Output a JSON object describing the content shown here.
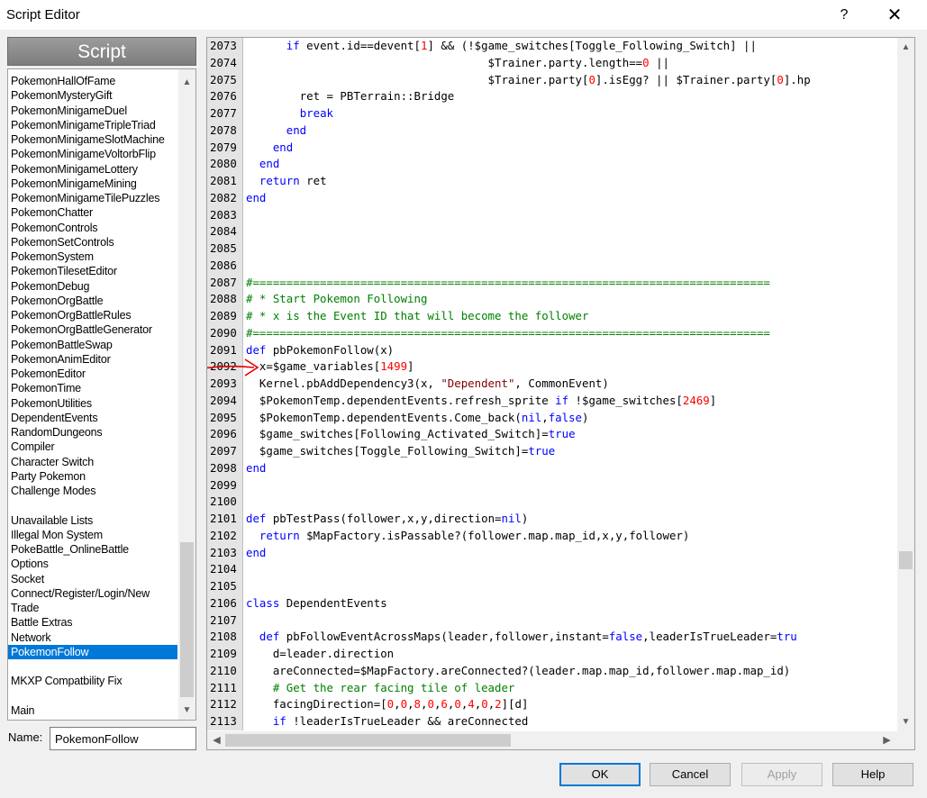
{
  "window": {
    "title": "Script Editor",
    "help_label": "?",
    "close_label": "✕"
  },
  "sidebar": {
    "header": "Script",
    "items": [
      {
        "label": "PokemonHallOfFame"
      },
      {
        "label": "PokemonMysteryGift"
      },
      {
        "label": "PokemonMinigameDuel"
      },
      {
        "label": "PokemonMinigameTripleTriad"
      },
      {
        "label": "PokemonMinigameSlotMachine"
      },
      {
        "label": "PokemonMinigameVoltorbFlip"
      },
      {
        "label": "PokemonMinigameLottery"
      },
      {
        "label": "PokemonMinigameMining"
      },
      {
        "label": "PokemonMinigameTilePuzzles"
      },
      {
        "label": "PokemonChatter"
      },
      {
        "label": "PokemonControls"
      },
      {
        "label": "PokemonSetControls"
      },
      {
        "label": "PokemonSystem"
      },
      {
        "label": "PokemonTilesetEditor"
      },
      {
        "label": "PokemonDebug"
      },
      {
        "label": "PokemonOrgBattle"
      },
      {
        "label": "PokemonOrgBattleRules"
      },
      {
        "label": "PokemonOrgBattleGenerator"
      },
      {
        "label": "PokemonBattleSwap"
      },
      {
        "label": "PokemonAnimEditor"
      },
      {
        "label": "PokemonEditor"
      },
      {
        "label": "PokemonTime"
      },
      {
        "label": "PokemonUtilities"
      },
      {
        "label": "DependentEvents"
      },
      {
        "label": "RandomDungeons"
      },
      {
        "label": "Compiler"
      },
      {
        "label": "Character Switch"
      },
      {
        "label": "Party Pokemon"
      },
      {
        "label": "Challenge Modes"
      },
      {
        "label": ""
      },
      {
        "label": "Unavailable Lists"
      },
      {
        "label": "Illegal Mon System"
      },
      {
        "label": "PokeBattle_OnlineBattle"
      },
      {
        "label": "Options"
      },
      {
        "label": "Socket"
      },
      {
        "label": "Connect/Register/Login/New"
      },
      {
        "label": "Trade"
      },
      {
        "label": "Battle Extras"
      },
      {
        "label": "Network"
      },
      {
        "label": "PokemonFollow",
        "selected": true
      },
      {
        "label": ""
      },
      {
        "label": "MKXP Compatbility Fix"
      },
      {
        "label": ""
      },
      {
        "label": "Main"
      }
    ]
  },
  "name_field": {
    "label": "Name:",
    "value": "PokemonFollow"
  },
  "editor": {
    "lines": [
      {
        "n": "2073",
        "t": [
          [
            "      ",
            ""
          ],
          [
            "if",
            "kw"
          ],
          [
            " event.id==devent[",
            ""
          ],
          [
            "1",
            "num"
          ],
          [
            "] && (!$game_switches[Toggle_Following_Switch] ||",
            ""
          ]
        ]
      },
      {
        "n": "2074",
        "t": [
          [
            "                                    $Trainer.party.length==",
            ""
          ],
          [
            "0",
            "num"
          ],
          [
            " ||",
            ""
          ]
        ]
      },
      {
        "n": "2075",
        "t": [
          [
            "                                    $Trainer.party[",
            ""
          ],
          [
            "0",
            "num"
          ],
          [
            "].isEgg? || $Trainer.party[",
            ""
          ],
          [
            "0",
            "num"
          ],
          [
            "].hp",
            ""
          ]
        ]
      },
      {
        "n": "2076",
        "t": [
          [
            "        ret = PBTerrain::Bridge",
            ""
          ]
        ]
      },
      {
        "n": "2077",
        "t": [
          [
            "        ",
            ""
          ],
          [
            "break",
            "kw"
          ]
        ]
      },
      {
        "n": "2078",
        "t": [
          [
            "      ",
            ""
          ],
          [
            "end",
            "kw"
          ]
        ]
      },
      {
        "n": "2079",
        "t": [
          [
            "    ",
            ""
          ],
          [
            "end",
            "kw"
          ]
        ]
      },
      {
        "n": "2080",
        "t": [
          [
            "  ",
            ""
          ],
          [
            "end",
            "kw"
          ]
        ]
      },
      {
        "n": "2081",
        "t": [
          [
            "  ",
            ""
          ],
          [
            "return",
            "kw"
          ],
          [
            " ret",
            ""
          ]
        ]
      },
      {
        "n": "2082",
        "t": [
          [
            "end",
            "kw"
          ]
        ]
      },
      {
        "n": "2083",
        "t": []
      },
      {
        "n": "2084",
        "t": []
      },
      {
        "n": "2085",
        "t": []
      },
      {
        "n": "2086",
        "t": []
      },
      {
        "n": "2087",
        "t": [
          [
            "#=============================================================================",
            "cm"
          ]
        ]
      },
      {
        "n": "2088",
        "t": [
          [
            "# * Start Pokemon Following",
            "cm"
          ]
        ]
      },
      {
        "n": "2089",
        "t": [
          [
            "# * x is the Event ID that will become the follower",
            "cm"
          ]
        ]
      },
      {
        "n": "2090",
        "t": [
          [
            "#=============================================================================",
            "cm"
          ]
        ]
      },
      {
        "n": "2091",
        "t": [
          [
            "def",
            "kw"
          ],
          [
            " pbPokemonFollow(x)",
            ""
          ]
        ]
      },
      {
        "n": "2092",
        "t": [
          [
            "  x=$game_variables[",
            ""
          ],
          [
            "1499",
            "num"
          ],
          [
            "]",
            ""
          ]
        ],
        "annotated": true
      },
      {
        "n": "2093",
        "t": [
          [
            "  Kernel.pbAddDependency3(x, ",
            ""
          ],
          [
            "\"Dependent\"",
            "str"
          ],
          [
            ", CommonEvent)",
            ""
          ]
        ]
      },
      {
        "n": "2094",
        "t": [
          [
            "  $PokemonTemp.dependentEvents.refresh_sprite ",
            ""
          ],
          [
            "if",
            "kw"
          ],
          [
            " !$game_switches[",
            ""
          ],
          [
            "2469",
            "num"
          ],
          [
            "]",
            ""
          ]
        ]
      },
      {
        "n": "2095",
        "t": [
          [
            "  $PokemonTemp.dependentEvents.Come_back(",
            ""
          ],
          [
            "nil",
            "kw"
          ],
          [
            ",",
            ""
          ],
          [
            "false",
            "kw"
          ],
          [
            ")",
            ""
          ]
        ]
      },
      {
        "n": "2096",
        "t": [
          [
            "  $game_switches[Following_Activated_Switch]=",
            ""
          ],
          [
            "true",
            "kw"
          ]
        ]
      },
      {
        "n": "2097",
        "t": [
          [
            "  $game_switches[Toggle_Following_Switch]=",
            ""
          ],
          [
            "true",
            "kw"
          ]
        ]
      },
      {
        "n": "2098",
        "t": [
          [
            "end",
            "kw"
          ]
        ]
      },
      {
        "n": "2099",
        "t": []
      },
      {
        "n": "2100",
        "t": []
      },
      {
        "n": "2101",
        "t": [
          [
            "def",
            "kw"
          ],
          [
            " pbTestPass(follower,x,y,direction=",
            ""
          ],
          [
            "nil",
            "kw"
          ],
          [
            ")",
            ""
          ]
        ]
      },
      {
        "n": "2102",
        "t": [
          [
            "  ",
            ""
          ],
          [
            "return",
            "kw"
          ],
          [
            " $MapFactory.isPassable?(follower.map.map_id,x,y,follower)",
            ""
          ]
        ]
      },
      {
        "n": "2103",
        "t": [
          [
            "end",
            "kw"
          ]
        ]
      },
      {
        "n": "2104",
        "t": []
      },
      {
        "n": "2105",
        "t": []
      },
      {
        "n": "2106",
        "t": [
          [
            "class",
            "kw"
          ],
          [
            " DependentEvents",
            ""
          ]
        ]
      },
      {
        "n": "2107",
        "t": []
      },
      {
        "n": "2108",
        "t": [
          [
            "  ",
            ""
          ],
          [
            "def",
            "kw"
          ],
          [
            " pbFollowEventAcrossMaps(leader,follower,instant=",
            ""
          ],
          [
            "false",
            "kw"
          ],
          [
            ",leaderIsTrueLeader=",
            ""
          ],
          [
            "tru",
            "kw"
          ]
        ]
      },
      {
        "n": "2109",
        "t": [
          [
            "    d=leader.direction",
            ""
          ]
        ]
      },
      {
        "n": "2110",
        "t": [
          [
            "    areConnected=$MapFactory.areConnected?(leader.map.map_id,follower.map.map_id)",
            ""
          ]
        ]
      },
      {
        "n": "2111",
        "t": [
          [
            "    # Get the rear facing tile of leader",
            "cm"
          ]
        ]
      },
      {
        "n": "2112",
        "t": [
          [
            "    facingDirection=[",
            ""
          ],
          [
            "0",
            "num"
          ],
          [
            ",",
            ""
          ],
          [
            "0",
            "num"
          ],
          [
            ",",
            ""
          ],
          [
            "8",
            "num"
          ],
          [
            ",",
            ""
          ],
          [
            "0",
            "num"
          ],
          [
            ",",
            ""
          ],
          [
            "6",
            "num"
          ],
          [
            ",",
            ""
          ],
          [
            "0",
            "num"
          ],
          [
            ",",
            ""
          ],
          [
            "4",
            "num"
          ],
          [
            ",",
            ""
          ],
          [
            "0",
            "num"
          ],
          [
            ",",
            ""
          ],
          [
            "2",
            "num"
          ],
          [
            "][d]",
            ""
          ]
        ]
      },
      {
        "n": "2113",
        "t": [
          [
            "    ",
            ""
          ],
          [
            "if",
            "kw"
          ],
          [
            " !leaderIsTrueLeader && areConnected",
            ""
          ]
        ]
      }
    ]
  },
  "buttons": {
    "ok": "OK",
    "cancel": "Cancel",
    "apply": "Apply",
    "help": "Help"
  },
  "scroll_arrows": {
    "up": "▲",
    "down": "▼",
    "left": "◀",
    "right": "▶"
  }
}
